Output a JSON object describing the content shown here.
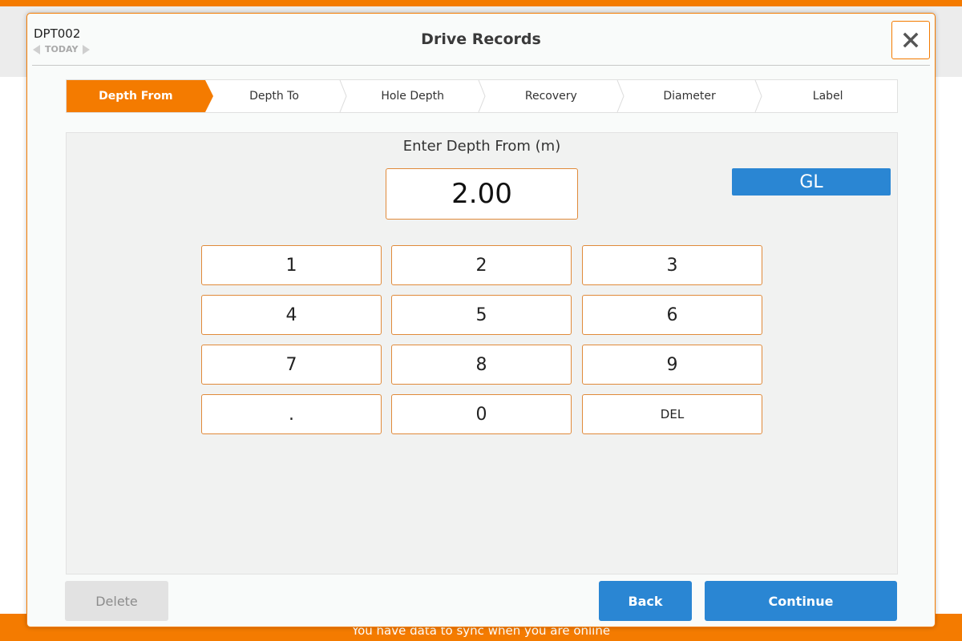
{
  "colors": {
    "accent": "#f47b00",
    "primary": "#2a86d3",
    "disabled": "#e2e2e2"
  },
  "header": {
    "record_id": "DPT002",
    "date_label": "TODAY",
    "title": "Drive Records"
  },
  "steps": [
    {
      "label": "Depth From",
      "active": true
    },
    {
      "label": "Depth To",
      "active": false
    },
    {
      "label": "Hole Depth",
      "active": false
    },
    {
      "label": "Recovery",
      "active": false
    },
    {
      "label": "Diameter",
      "active": false
    },
    {
      "label": "Label",
      "active": false
    }
  ],
  "entry": {
    "prompt": "Enter Depth From (m)",
    "value": "2.00",
    "gl_label": "GL"
  },
  "keypad": {
    "keys": [
      "1",
      "2",
      "3",
      "4",
      "5",
      "6",
      "7",
      "8",
      "9",
      ".",
      "0",
      "DEL"
    ]
  },
  "footer": {
    "delete_label": "Delete",
    "back_label": "Back",
    "continue_label": "Continue"
  },
  "background": {
    "status_text": "You have data to sync when you are online"
  },
  "icons": {
    "close": "close-icon",
    "prev": "chevron-left-icon",
    "next": "chevron-right-icon"
  }
}
